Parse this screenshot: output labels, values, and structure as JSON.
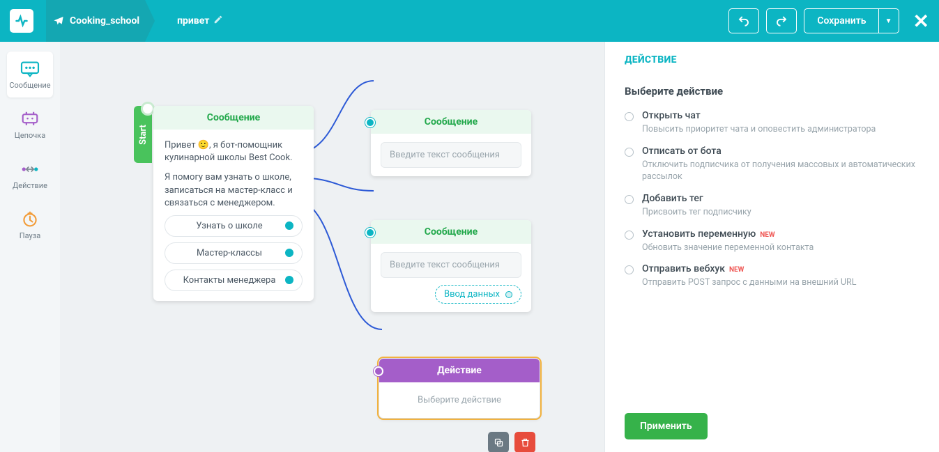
{
  "header": {
    "bot_name": "Cooking_school",
    "flow_name": "привет",
    "save": "Сохранить"
  },
  "sidebar": [
    {
      "label": "Сообщение"
    },
    {
      "label": "Цепочка"
    },
    {
      "label": "Действие"
    },
    {
      "label": "Пауза"
    }
  ],
  "start_label": "Start",
  "nodes": {
    "main": {
      "title": "Сообщение",
      "text_line1": "Привет 🙂, я бот-помощник кулинарной школы Best Cook.",
      "text_line2": "Я помогу вам узнать о школе, записаться на мастер-класс и связаться с менеджером.",
      "options": [
        "Узнать о школе",
        "Мастер-классы",
        "Контакты менеджера"
      ]
    },
    "msg2": {
      "title": "Сообщение",
      "placeholder": "Введите текст сообщения"
    },
    "msg3": {
      "title": "Сообщение",
      "placeholder": "Введите текст сообщения",
      "chip": "Ввод данных"
    },
    "action": {
      "title": "Действие",
      "placeholder": "Выберите действие"
    }
  },
  "panel": {
    "title": "ДЕЙСТВИЕ",
    "subtitle": "Выберите действие",
    "options": [
      {
        "h": "Открыть чат",
        "d": "Повысить приоритет чата и оповестить администратора",
        "new": false
      },
      {
        "h": "Отписать от бота",
        "d": "Отключить подписчика от получения массовых и автоматических рассылок",
        "new": false
      },
      {
        "h": "Добавить тег",
        "d": "Присвоить тег подписчику",
        "new": false
      },
      {
        "h": "Установить переменную",
        "d": "Обновить значение переменной контакта",
        "new": true
      },
      {
        "h": "Отправить вебхук",
        "d": "Отправить POST запрос с данными на внешний URL",
        "new": true
      }
    ],
    "new_label": "NEW",
    "apply": "Применить"
  }
}
